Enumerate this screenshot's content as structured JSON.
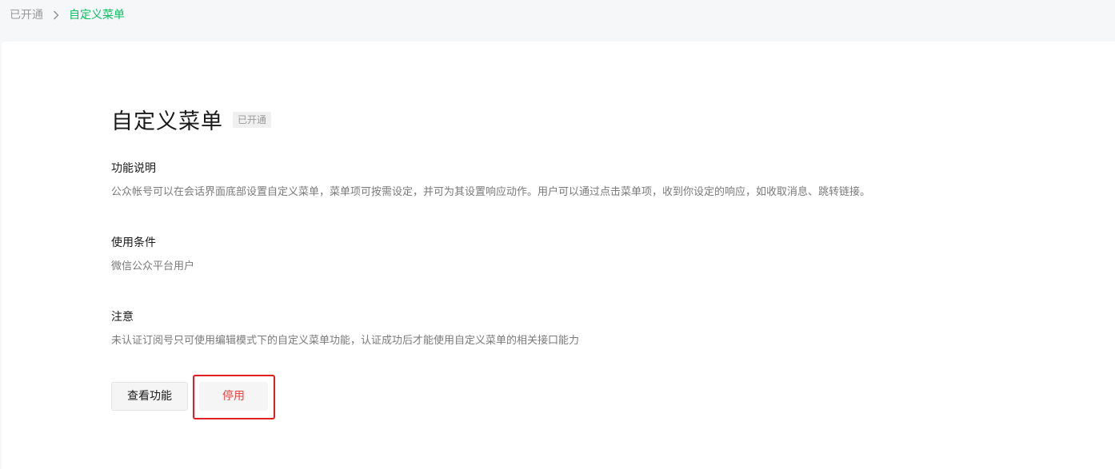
{
  "breadcrumb": {
    "parent": "已开通",
    "current": "自定义菜单"
  },
  "page": {
    "title": "自定义菜单",
    "status_tag": "已开通"
  },
  "sections": [
    {
      "title": "功能说明",
      "text": "公众帐号可以在会话界面底部设置自定义菜单，菜单项可按需设定，并可为其设置响应动作。用户可以通过点击菜单项，收到你设定的响应，如收取消息、跳转链接。"
    },
    {
      "title": "使用条件",
      "text": "微信公众平台用户"
    },
    {
      "title": "注意",
      "text": "未认证订阅号只可使用编辑模式下的自定义菜单功能，认证成功后才能使用自定义菜单的相关接口能力"
    }
  ],
  "actions": {
    "view_label": "查看功能",
    "disable_label": "停用"
  },
  "colors": {
    "accent": "#07c160",
    "danger": "#e64340",
    "highlight_border": "#e02020",
    "background": "#f6f7f9"
  }
}
